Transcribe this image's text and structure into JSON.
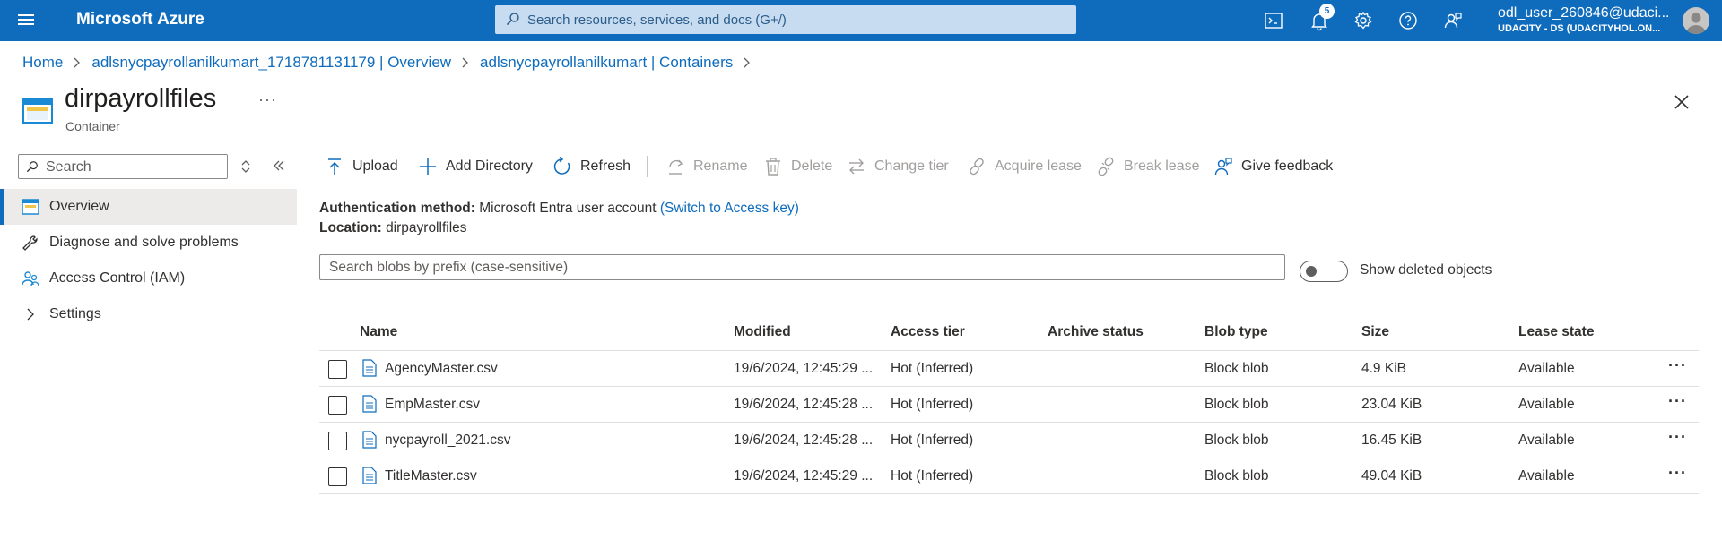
{
  "topbar": {
    "brand": "Microsoft Azure",
    "search_placeholder": "Search resources, services, and docs (G+/)",
    "notification_count": "5",
    "user_name": "odl_user_260846@udaci...",
    "user_tenant": "UDACITY - DS (UDACITYHOL.ON...",
    "icons": [
      "cloud-shell-icon",
      "bell-icon",
      "gear-icon",
      "help-icon",
      "feedback-icon"
    ]
  },
  "breadcrumb": {
    "items": [
      "Home",
      "adlsnycpayrollanilkumart_1718781131179 | Overview",
      "adlsnycpayrollanilkumart | Containers"
    ]
  },
  "page": {
    "title": "dirpayrollfiles",
    "ellipsis": "···",
    "subtitle": "Container"
  },
  "nav": {
    "search_placeholder": "Search",
    "items": [
      {
        "label": "Overview",
        "icon": "container-icon",
        "active": true
      },
      {
        "label": "Diagnose and solve problems",
        "icon": "wrench-icon"
      },
      {
        "label": "Access Control (IAM)",
        "icon": "people-icon"
      },
      {
        "label": "Settings",
        "icon": "chevron-right-icon"
      }
    ]
  },
  "toolbar": {
    "upload": "Upload",
    "add_directory": "Add Directory",
    "refresh": "Refresh",
    "rename": "Rename",
    "delete": "Delete",
    "change_tier": "Change tier",
    "acquire_lease": "Acquire lease",
    "break_lease": "Break lease",
    "give_feedback": "Give feedback"
  },
  "info": {
    "auth_label": "Authentication method:",
    "auth_value": "Microsoft Entra user account",
    "auth_link": "(Switch to Access key)",
    "location_label": "Location:",
    "location_value": "dirpayrollfiles"
  },
  "blob_search": {
    "placeholder": "Search blobs by prefix (case-sensitive)",
    "toggle_label": "Show deleted objects"
  },
  "table": {
    "columns": [
      "Name",
      "Modified",
      "Access tier",
      "Archive status",
      "Blob type",
      "Size",
      "Lease state"
    ],
    "rows": [
      {
        "name": "AgencyMaster.csv",
        "modified": "19/6/2024, 12:45:29 ...",
        "tier": "Hot (Inferred)",
        "archive": "",
        "type": "Block blob",
        "size": "4.9 KiB",
        "lease": "Available"
      },
      {
        "name": "EmpMaster.csv",
        "modified": "19/6/2024, 12:45:28 ...",
        "tier": "Hot (Inferred)",
        "archive": "",
        "type": "Block blob",
        "size": "23.04 KiB",
        "lease": "Available"
      },
      {
        "name": "nycpayroll_2021.csv",
        "modified": "19/6/2024, 12:45:28 ...",
        "tier": "Hot (Inferred)",
        "archive": "",
        "type": "Block blob",
        "size": "16.45 KiB",
        "lease": "Available"
      },
      {
        "name": "TitleMaster.csv",
        "modified": "19/6/2024, 12:45:29 ...",
        "tier": "Hot (Inferred)",
        "archive": "",
        "type": "Block blob",
        "size": "49.04 KiB",
        "lease": "Available"
      }
    ],
    "row_menu": "···"
  },
  "colors": {
    "topbar": "#0f6cbd",
    "link": "#0f6cbd",
    "nav_active": "#edebe9"
  }
}
